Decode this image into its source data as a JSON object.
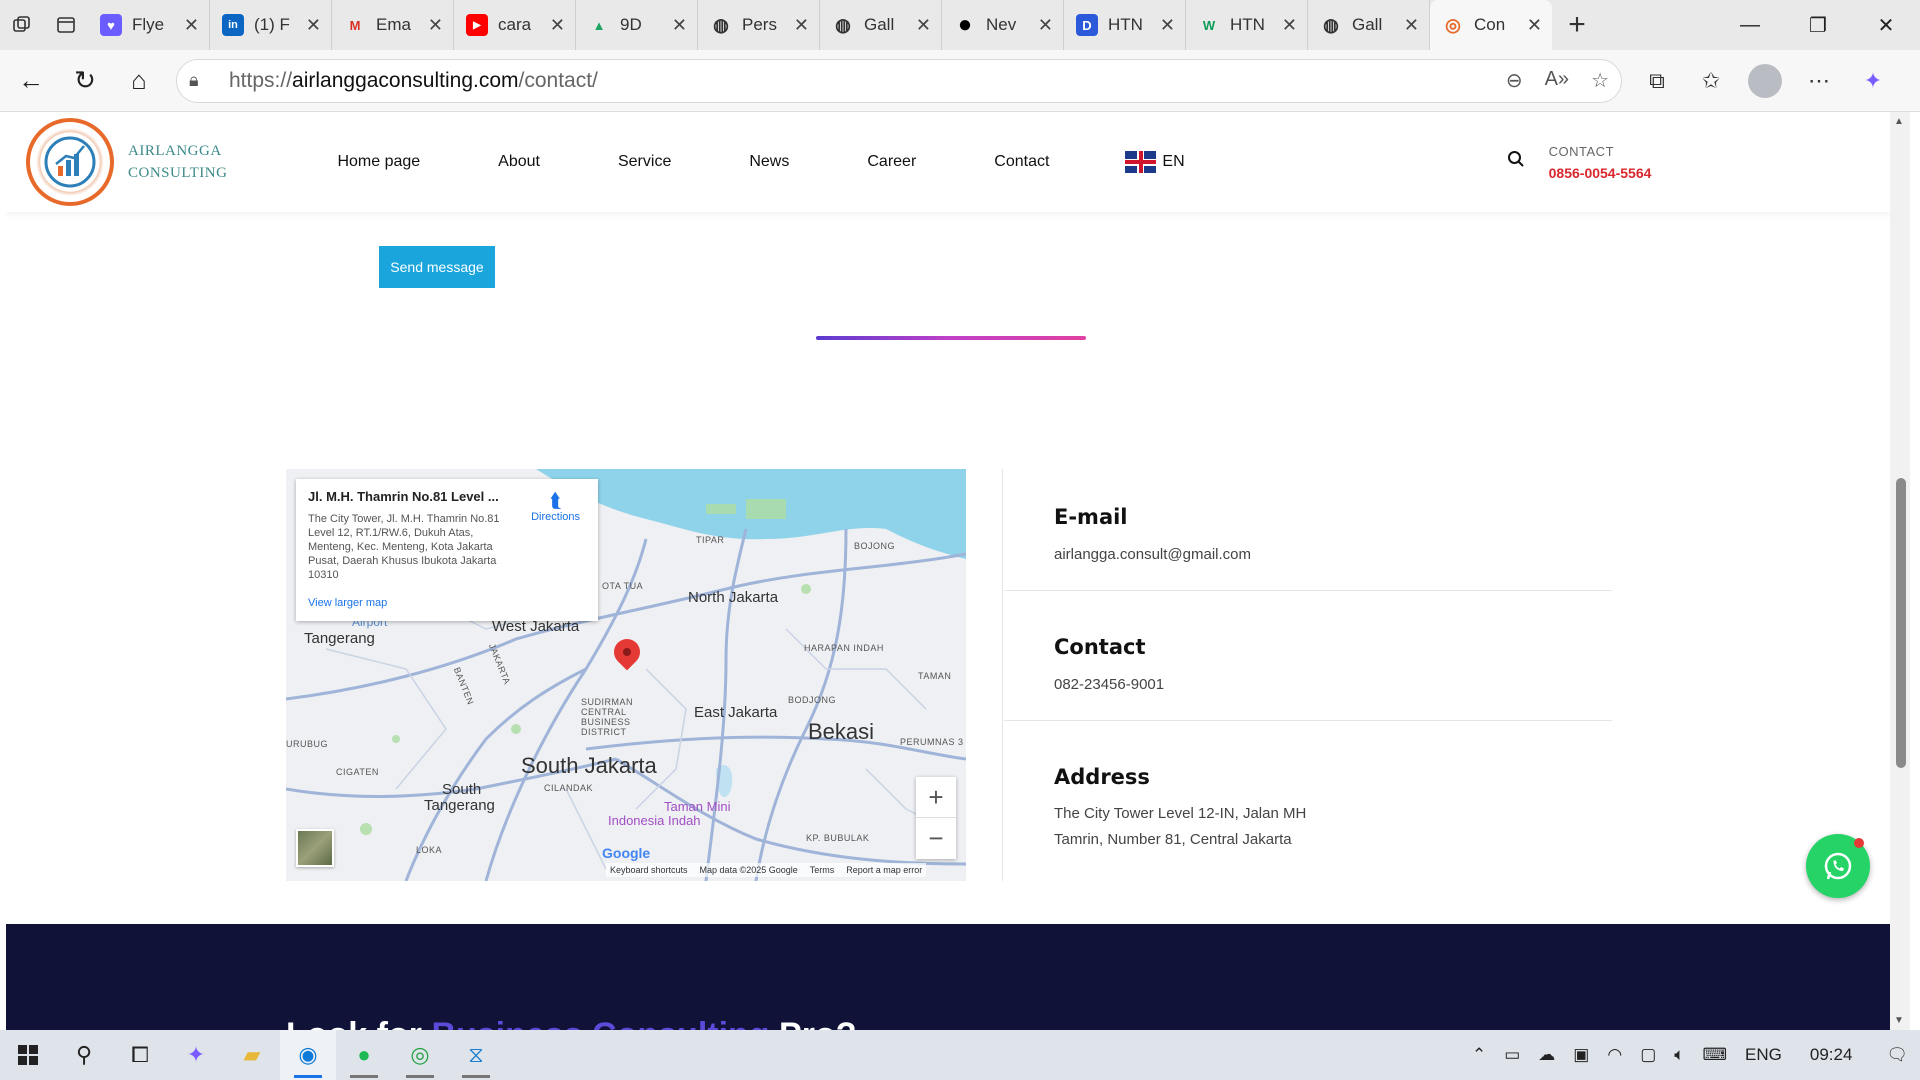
{
  "browser": {
    "tabs": [
      {
        "title": "Flye",
        "fav_color": "#6a5cff",
        "fav_glyph": "♥"
      },
      {
        "title": "(1) F",
        "fav_color": "#0a66c2",
        "fav_glyph": "in"
      },
      {
        "title": "Ema",
        "fav_color": "#ffffff",
        "fav_glyph": "M"
      },
      {
        "title": "cara",
        "fav_color": "#ff0000",
        "fav_glyph": "▶"
      },
      {
        "title": "9D",
        "fav_color": "#1fa463",
        "fav_glyph": "▲"
      },
      {
        "title": "Pers",
        "fav_color": "#ffffff",
        "fav_glyph": "◍"
      },
      {
        "title": "Gall",
        "fav_color": "#ffffff",
        "fav_glyph": "◍"
      },
      {
        "title": "Nev",
        "fav_color": "#000000",
        "fav_glyph": "●"
      },
      {
        "title": "HTN",
        "fav_color": "#2b59d9",
        "fav_glyph": "D"
      },
      {
        "title": "HTN",
        "fav_color": "#ffffff",
        "fav_glyph": "W"
      },
      {
        "title": "Gall",
        "fav_color": "#ffffff",
        "fav_glyph": "◍"
      },
      {
        "title": "Con",
        "fav_color": "#ffffff",
        "fav_glyph": "◎"
      }
    ],
    "url_prefix": "https://",
    "url_host": "airlanggaconsulting.com",
    "url_path": "/contact/"
  },
  "site": {
    "brand_line1": "AIRLANGGA",
    "brand_line2": "CONSULTING",
    "menu": [
      "Home page",
      "About",
      "Service",
      "News",
      "Career",
      "Contact"
    ],
    "lang": "EN",
    "contact_label": "CONTACT",
    "contact_phone": "0856-0054-5564"
  },
  "form": {
    "send_label": "Send message"
  },
  "map": {
    "place_title": "Jl. M.H. Thamrin No.81 Level ...",
    "place_address": "The City Tower, Jl. M.H. Thamrin No.81 Level 12, RT.1/RW.6, Dukuh Atas, Menteng, Kec. Menteng, Kota Jakarta Pusat, Daerah Khusus Ibukota Jakarta 10310",
    "directions": "Directions",
    "larger_map": "View larger map",
    "labels": {
      "north_jakarta": "North Jakarta",
      "west_jakarta": "West Jakarta",
      "tangerang": "Tangerang",
      "east_jakarta": "East Jakarta",
      "bekasi": "Bekasi",
      "south_jakarta": "South Jakarta",
      "south_tangerang_1": "South",
      "south_tangerang_2": "Tangerang",
      "taman_mini_1": "Taman Mini",
      "taman_mini_2": "Indonesia Indah",
      "tipar": "TIPAR",
      "bojong": "BOJONG",
      "harapan_indah": "HARAPAN INDAH",
      "taman": "TAMAN",
      "bodjong": "BODJONG",
      "sudirman": "SUDIRMAN",
      "central": "CENTRAL",
      "business": "BUSINESS",
      "district": "DISTRICT",
      "perumnas": "PERUMNAS 3",
      "urubug": "URUBUG",
      "cigaten": "CIGATEN",
      "cilandak": "CILANDAK",
      "kp_bubulak": "KP. BUBULAK",
      "loka": "LOKA",
      "banten": "BANTEN",
      "jakarta": "JAKARTA",
      "airport": "Airport",
      "ota_tua": "OTA TUA"
    },
    "google": "Google",
    "attrib": [
      "Keyboard shortcuts",
      "Map data ©2025 Google",
      "Terms",
      "Report a map error"
    ]
  },
  "contact_info": [
    {
      "heading": "E-mail",
      "value": "airlangga.consult@gmail.com"
    },
    {
      "heading": "Contact",
      "value": "082-23456-9001"
    },
    {
      "heading": "Address",
      "value": "The City Tower Level 12-IN, Jalan MH Tamrin, Number 81, Central Jakarta"
    }
  ],
  "footer": {
    "heading_a": "Look for ",
    "heading_b": "Business Consulting",
    "heading_c": " Pro?"
  },
  "taskbar": {
    "lang": "ENG",
    "time": "09:24"
  },
  "colors": {
    "accent_blue": "#1aa6dc",
    "phone_red": "#d9272e",
    "footer_bg": "#111238",
    "whatsapp": "#25d366"
  }
}
